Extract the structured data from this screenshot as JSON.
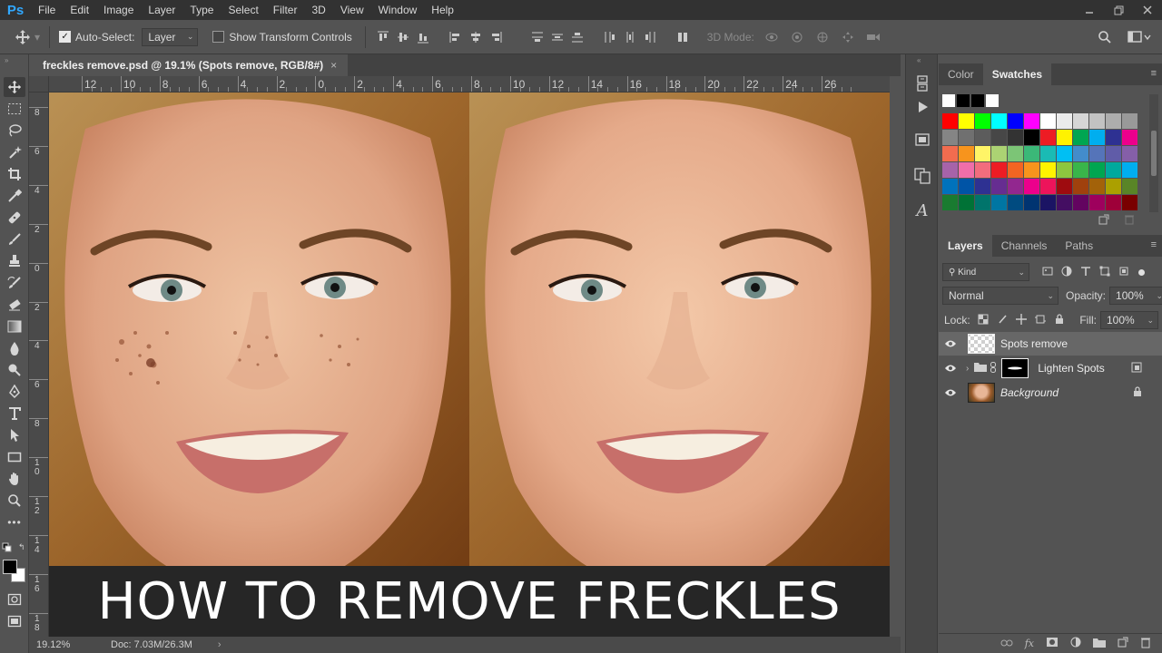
{
  "app": {
    "logo": "Ps"
  },
  "menu": [
    "File",
    "Edit",
    "Image",
    "Layer",
    "Type",
    "Select",
    "Filter",
    "3D",
    "View",
    "Window",
    "Help"
  ],
  "options": {
    "auto_select_label": "Auto-Select:",
    "auto_select_checked": true,
    "auto_select_target": "Layer",
    "show_transform_label": "Show Transform Controls",
    "show_transform_checked": false,
    "mode_3d_label": "3D Mode:"
  },
  "document": {
    "tab_title": "freckles remove.psd @ 19.1% (Spots remove, RGB/8#)"
  },
  "ruler": {
    "horizontal": [
      "12",
      "10",
      "8",
      "6",
      "4",
      "2",
      "0",
      "2",
      "4",
      "6",
      "8",
      "10",
      "12",
      "14",
      "16",
      "18",
      "20",
      "22",
      "24",
      "26"
    ],
    "vertical": [
      "8",
      "6",
      "4",
      "2",
      "0",
      "2",
      "4",
      "6",
      "8",
      "10",
      "12",
      "14",
      "16",
      "18"
    ]
  },
  "canvas": {
    "banner_text": "HOW TO REMOVE FRECKLES"
  },
  "status": {
    "zoom": "19.12%",
    "doc_info": "Doc: 7.03M/26.3M"
  },
  "color_panel": {
    "tabs": [
      "Color",
      "Swatches"
    ],
    "active_tab": "Swatches"
  },
  "swatches": {
    "rows": [
      [
        "#ffffff",
        "#000000",
        "#000000",
        "#ffffff"
      ],
      [
        "#ff0000",
        "#ffff00",
        "#00ff00",
        "#00ffff",
        "#0000ff",
        "#ff00ff",
        "#ffffff",
        "#ebebeb",
        "#d6d6d6",
        "#c2c2c2",
        "#adadad",
        "#999999"
      ],
      [
        "#858585",
        "#707070",
        "#5c5c5c",
        "#474747",
        "#333333",
        "#000000",
        "#ed1c24",
        "#fff200",
        "#00a651",
        "#00aeef",
        "#2e3192",
        "#ec008c"
      ],
      [
        "#f26c4f",
        "#f7941d",
        "#fff467",
        "#acd373",
        "#7cc576",
        "#3bb878",
        "#1abbb4",
        "#00bff3",
        "#438ccb",
        "#5574b9",
        "#605ca8",
        "#855fa8"
      ],
      [
        "#a763a9",
        "#f06ea9",
        "#f26d7d",
        "#ed1c24",
        "#f26522",
        "#f7941d",
        "#fff200",
        "#8dc63f",
        "#39b54a",
        "#00a651",
        "#00a99d",
        "#00aeef"
      ],
      [
        "#0072bc",
        "#0054a6",
        "#2e3192",
        "#662d91",
        "#92278f",
        "#ec008c",
        "#ed145b",
        "#9e0b0f",
        "#a0410d",
        "#a36209",
        "#aba000",
        "#598527"
      ],
      [
        "#197b30",
        "#007236",
        "#00746b",
        "#0076a3",
        "#004b80",
        "#003471",
        "#1b1464",
        "#440e62",
        "#630460",
        "#9e005d",
        "#9e0039",
        "#790000"
      ]
    ]
  },
  "layers_panel": {
    "tabs": [
      "Layers",
      "Channels",
      "Paths"
    ],
    "active_tab": "Layers",
    "filter_label": "Kind",
    "blend_mode": "Normal",
    "opacity_label": "Opacity:",
    "opacity": "100%",
    "lock_label": "Lock:",
    "fill_label": "Fill:",
    "fill": "100%",
    "layers": [
      {
        "name": "Spots remove",
        "selected": true
      },
      {
        "name": "Lighten Spots",
        "selected": false
      },
      {
        "name": "Background",
        "selected": false
      }
    ]
  },
  "icons": {
    "fx": "fx"
  }
}
